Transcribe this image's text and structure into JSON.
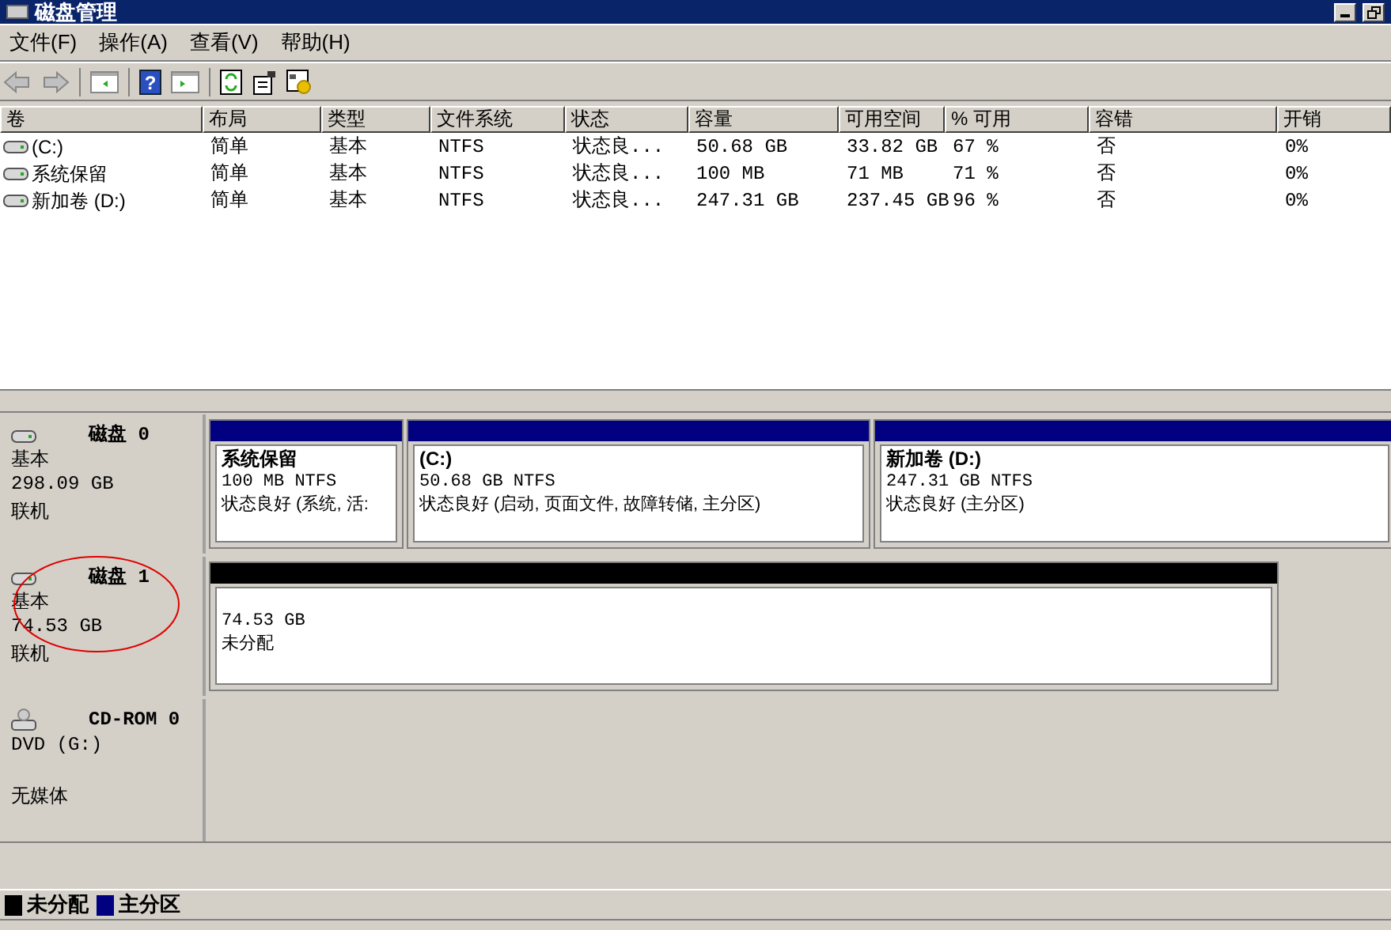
{
  "window": {
    "title": "磁盘管理"
  },
  "menu": [
    "文件(F)",
    "操作(A)",
    "查看(V)",
    "帮助(H)"
  ],
  "table": {
    "columns": [
      "卷",
      "布局",
      "类型",
      "文件系统",
      "状态",
      "容量",
      "可用空间",
      "% 可用",
      "容错",
      "开销"
    ],
    "rows": [
      [
        "(C:)",
        "简单",
        "基本",
        "NTFS",
        "状态良...",
        "50.68 GB",
        "33.82 GB",
        "67 %",
        "否",
        "0%"
      ],
      [
        "系统保留",
        "简单",
        "基本",
        "NTFS",
        "状态良...",
        "100 MB",
        "71 MB",
        "71 %",
        "否",
        "0%"
      ],
      [
        "新加卷 (D:)",
        "简单",
        "基本",
        "NTFS",
        "状态良...",
        "247.31 GB",
        "237.45 GB",
        "96 %",
        "否",
        "0%"
      ]
    ]
  },
  "disks": [
    {
      "kind": "disk",
      "name": "磁盘 0",
      "type": "基本",
      "size": "298.09 GB",
      "status": "联机",
      "partitions": [
        {
          "kind": "primary",
          "name": "系统保留",
          "detail": "100 MB NTFS",
          "status": "状态良好 (系统, 活:"
        },
        {
          "kind": "primary",
          "name": "(C:)",
          "detail": "50.68 GB NTFS",
          "status": "状态良好 (启动, 页面文件, 故障转储, 主分区)"
        },
        {
          "kind": "primary",
          "name": "新加卷 (D:)",
          "detail": "247.31 GB NTFS",
          "status": "状态良好 (主分区)"
        }
      ]
    },
    {
      "kind": "disk",
      "name": "磁盘 1",
      "type": "基本",
      "size": "74.53 GB",
      "status": "联机",
      "partitions": [
        {
          "kind": "unallocated",
          "detail": "74.53 GB",
          "status": "未分配"
        }
      ]
    },
    {
      "kind": "cdrom",
      "name": "CD-ROM 0",
      "type": "DVD (G:)",
      "status": "无媒体"
    }
  ],
  "toolbar": {
    "help_glyph": "?"
  },
  "legend": [
    {
      "label": "未分配",
      "color": "#000000"
    },
    {
      "label": "主分区",
      "color": "#000080"
    }
  ]
}
